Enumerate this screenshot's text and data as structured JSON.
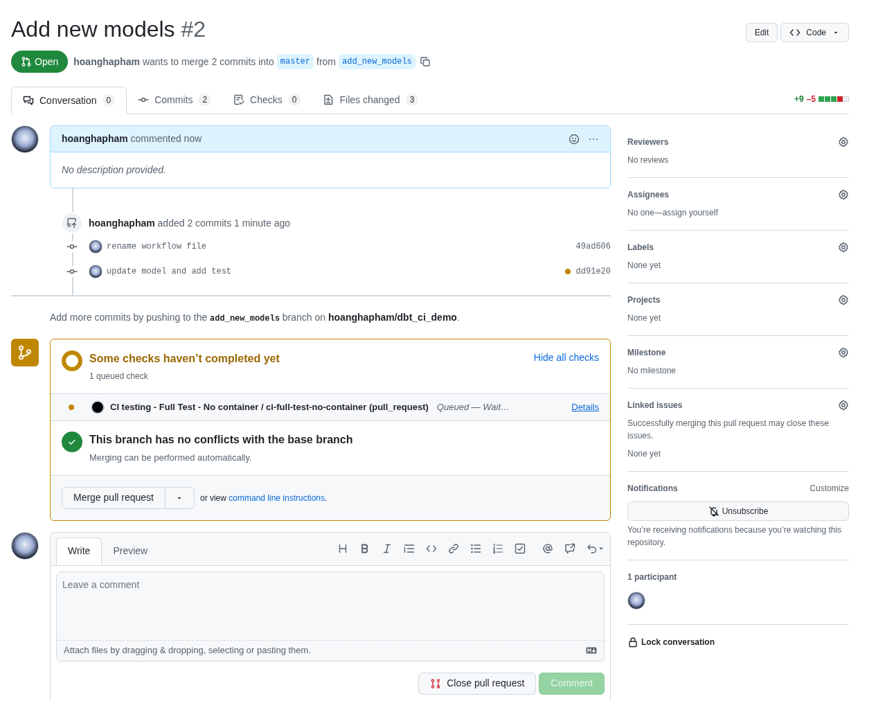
{
  "header": {
    "title": "Add new models",
    "number": "#2",
    "buttons": [
      {
        "kind": "edit",
        "label": "Edit"
      },
      {
        "kind": "code",
        "label": "Code"
      }
    ]
  },
  "summary": {
    "state": "Open",
    "author": "hoanghapham",
    "text": "wants to merge 2 commits into",
    "base": "master",
    "from": "from",
    "head": "add_new_models"
  },
  "tabs": [
    {
      "kind": "conversation",
      "label": "Conversation",
      "count": "0",
      "selected": true
    },
    {
      "kind": "commits",
      "label": "Commits",
      "count": "2",
      "selected": false
    },
    {
      "kind": "checks",
      "label": "Checks",
      "count": "0",
      "selected": false
    },
    {
      "kind": "files",
      "label": "Files changed",
      "count": "3",
      "selected": false
    }
  ],
  "diffstat": {
    "added": "+9",
    "removed": "–5",
    "blocks": [
      {
        "kind": "added"
      },
      {
        "kind": "added"
      },
      {
        "kind": "added"
      },
      {
        "kind": "removed"
      },
      {
        "kind": "neutral"
      }
    ]
  },
  "comment": {
    "author": "hoanghapham",
    "meta": "commented now",
    "body": "No description provided."
  },
  "commit_event": {
    "author": "hoanghapham",
    "text": "added 2 commits 1 minute ago",
    "commits": [
      {
        "message": "rename workflow file",
        "sha": "49ad606",
        "pending": false
      },
      {
        "message": "update model and add test",
        "sha": "dd91e20",
        "pending": true
      }
    ]
  },
  "push_hint": [
    {
      "kind": "text",
      "text": "Add more commits by pushing to the "
    },
    {
      "kind": "code",
      "text": "add_new_models"
    },
    {
      "kind": "text",
      "text": " branch on "
    },
    {
      "kind": "strong",
      "text": "hoanghapham/dbt_ci_demo"
    },
    {
      "kind": "text",
      "text": "."
    }
  ],
  "merge_box": {
    "checks_title": "Some checks haven’t completed yet",
    "checks_subtitle": "1 queued check",
    "hide_link": "Hide all checks",
    "checks": [
      {
        "name": "CI testing - Full Test - No container",
        "job": " / ci-full-test-no-container (pull_request)",
        "status": "Queued — Wait…",
        "link": "Details",
        "kind": "queued"
      }
    ],
    "conflicts_title": "This branch has no conflicts with the base branch",
    "conflicts_subtitle": "Merging can be performed automatically.",
    "merge_button": "Merge pull request",
    "or_view": "or view",
    "cli_link": "command line instructions",
    "period": "."
  },
  "comment_form": {
    "tabs": [
      {
        "label": "Write",
        "selected": true
      },
      {
        "label": "Preview",
        "selected": false
      }
    ],
    "toolbar": [
      {
        "kind": "heading"
      },
      {
        "kind": "bold"
      },
      {
        "kind": "italic"
      },
      {
        "kind": "quote"
      },
      {
        "kind": "code"
      },
      {
        "kind": "link"
      },
      {
        "kind": "bullets"
      },
      {
        "kind": "numbers"
      },
      {
        "kind": "tasks"
      },
      {
        "kind": "mention"
      },
      {
        "kind": "reference"
      },
      {
        "kind": "undo"
      }
    ],
    "placeholder": "Leave a comment",
    "attach": "Attach files by dragging & dropping, selecting or pasting them.",
    "close_button": "Close pull request",
    "comment_button": {
      "label": "Comment",
      "disabled": true
    }
  },
  "sidebar": {
    "sections": [
      {
        "title": "Reviewers",
        "lines": [
          "No reviews"
        ]
      },
      {
        "title": "Assignees",
        "lines": [
          "No one—assign yourself"
        ]
      },
      {
        "title": "Labels",
        "lines": [
          "None yet"
        ]
      },
      {
        "title": "Projects",
        "lines": [
          "None yet"
        ]
      },
      {
        "title": "Milestone",
        "lines": [
          "No milestone"
        ]
      },
      {
        "title": "Linked issues",
        "lines": [
          "Successfully merging this pull request may close these issues.",
          "None yet"
        ]
      }
    ],
    "notifications": {
      "title": "Notifications",
      "customize": "Customize",
      "button": "Unsubscribe",
      "note": "You’re receiving notifications because you’re watching this repository."
    },
    "participants": "1 participant",
    "lock": "Lock conversation"
  }
}
